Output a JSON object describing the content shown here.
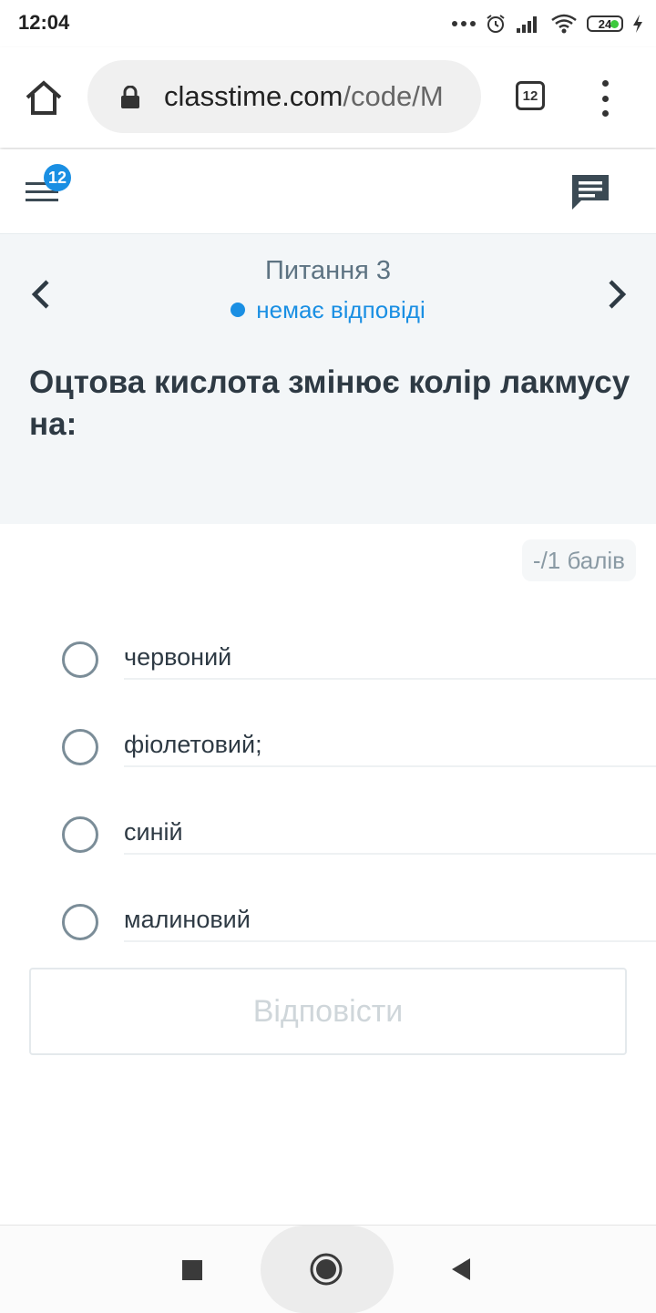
{
  "status_bar": {
    "time": "12:04",
    "battery": "24"
  },
  "browser": {
    "url_domain": "classtime.com",
    "url_path": "/code/M",
    "tab_count": "12"
  },
  "app_header": {
    "badge_count": "12"
  },
  "question": {
    "number_label": "Питання 3",
    "status_label": "немає відповіді",
    "text": "Оцтова кислота змінює колір лакмусу на:",
    "points": "-/1 балів",
    "options": [
      {
        "label": "червоний"
      },
      {
        "label": "фіолетовий;"
      },
      {
        "label": "синій"
      },
      {
        "label": "малиновий"
      }
    ],
    "submit_label": "Відповісти"
  },
  "colors": {
    "accent": "#1a8fe3",
    "panel_bg": "#f3f6f8",
    "text_dark": "#2e3a44",
    "text_muted": "#5d7382"
  }
}
